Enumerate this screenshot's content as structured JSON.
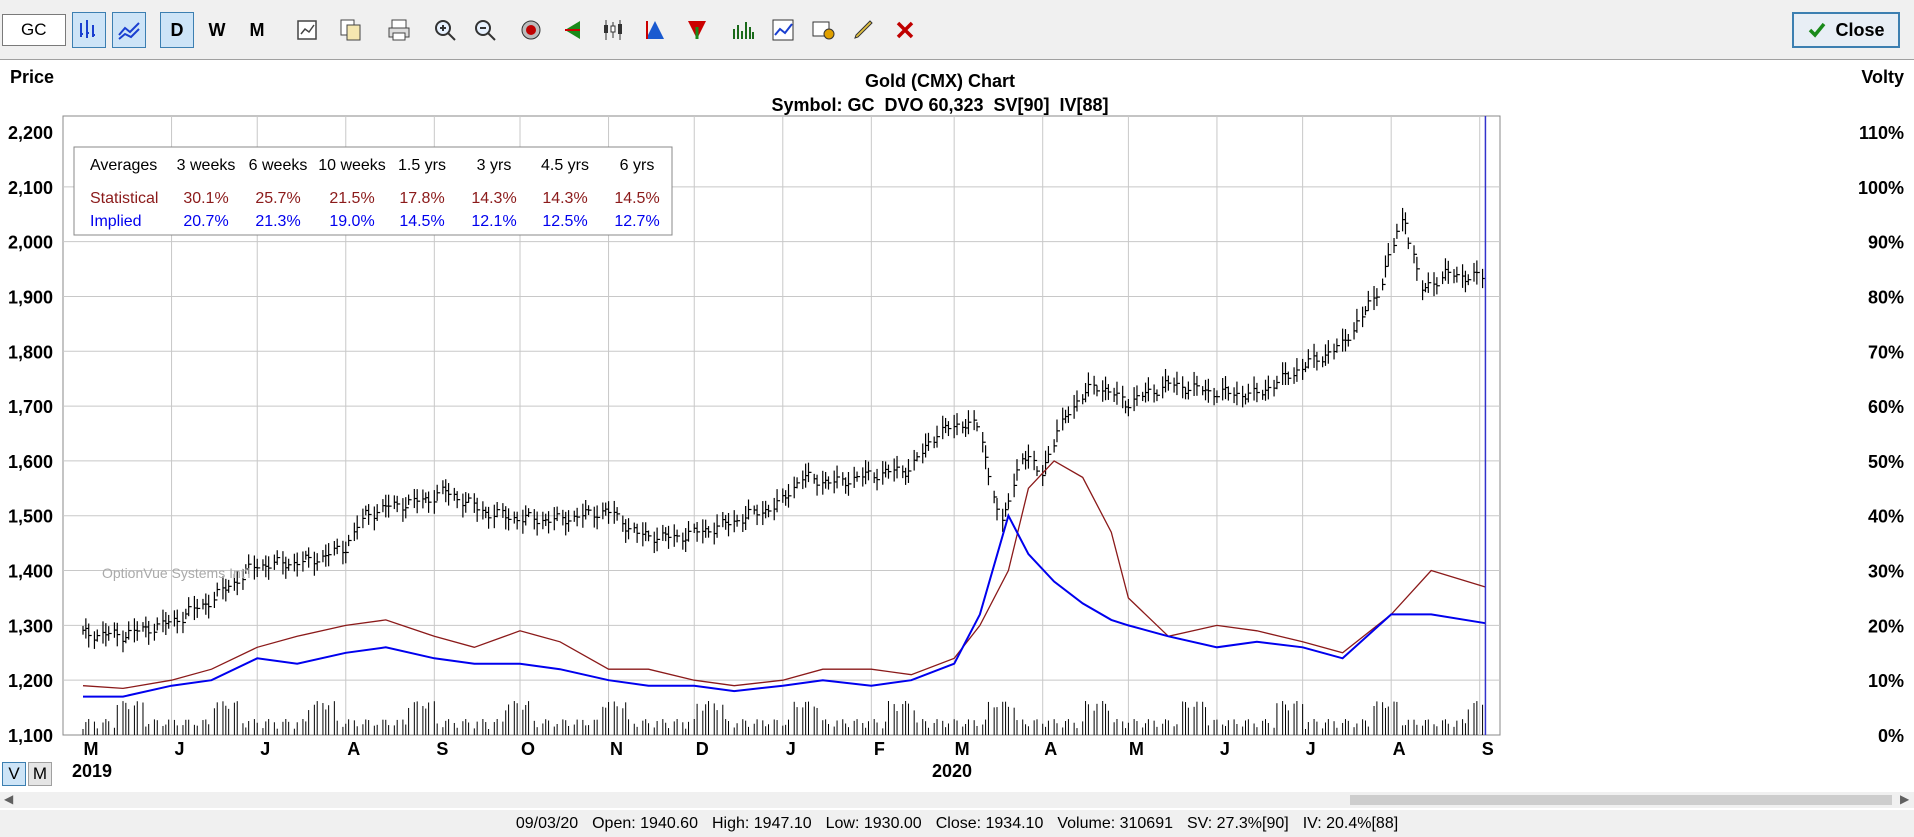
{
  "toolbar": {
    "symbol_value": "GC",
    "period_buttons": [
      "D",
      "W",
      "M"
    ],
    "close_label": "Close",
    "icons": [
      "bar-chart-icon",
      "line-chart-icon",
      "period-daily",
      "period-weekly",
      "period-monthly",
      "chart-settings-icon",
      "copy-icon",
      "print-icon",
      "zoom-in-icon",
      "zoom-out-icon",
      "target-icon",
      "left-arrow-icon",
      "candlestick-icon",
      "triangle-up-icon",
      "triangle-down-icon",
      "volume-icon",
      "study-icon",
      "annotation-icon",
      "pencil-icon",
      "delete-icon"
    ]
  },
  "chart_data": {
    "type": "line",
    "title": "Gold (CMX) Chart",
    "subtitle": "Symbol: GC  DVO 60,323  SV[90]  IV[88]",
    "ylabel": "Price",
    "y2label": "Volty",
    "ylim": [
      1100,
      2200
    ],
    "y2lim": [
      0,
      110
    ],
    "yticks": [
      "2,200",
      "2,100",
      "2,000",
      "1,900",
      "1,800",
      "1,700",
      "1,600",
      "1,500",
      "1,400",
      "1,300",
      "1,200",
      "1,100"
    ],
    "y2ticks": [
      "110%",
      "100%",
      "90%",
      "80%",
      "70%",
      "60%",
      "50%",
      "40%",
      "30%",
      "20%",
      "10%",
      "0%"
    ],
    "xticks": [
      "M",
      "J",
      "J",
      "A",
      "S",
      "O",
      "N",
      "D",
      "J",
      "F",
      "M",
      "A",
      "M",
      "J",
      "J",
      "A",
      "S"
    ],
    "years": [
      "2019",
      "2020"
    ],
    "x_dates": [
      "2019-05-01",
      "2019-06-01",
      "2019-07-01",
      "2019-08-01",
      "2019-09-01",
      "2019-10-01",
      "2019-11-01",
      "2019-12-01",
      "2020-01-01",
      "2020-02-01",
      "2020-03-01",
      "2020-04-01",
      "2020-05-01",
      "2020-06-01",
      "2020-07-01",
      "2020-08-01",
      "2020-09-01"
    ],
    "averages_table": {
      "header": [
        "Averages",
        "3 weeks",
        "6 weeks",
        "10 weeks",
        "1.5 yrs",
        "3 yrs",
        "4.5 yrs",
        "6 yrs"
      ],
      "rows": [
        {
          "label": "Statistical",
          "values": [
            "30.1%",
            "25.7%",
            "21.5%",
            "17.8%",
            "14.3%",
            "14.3%",
            "14.5%"
          ]
        },
        {
          "label": "Implied",
          "values": [
            "20.7%",
            "21.3%",
            "19.0%",
            "14.5%",
            "12.1%",
            "12.5%",
            "12.7%"
          ]
        }
      ]
    },
    "watermark": "OptionVue Systems Int'l",
    "colors": {
      "price": "#000000",
      "statistical": "#8b1a1a",
      "implied": "#0000ee",
      "grid": "#c8c8c8",
      "cursor": "#3333cc"
    },
    "series": [
      {
        "name": "Price",
        "axis": "price",
        "x": [
          "2019-05-01",
          "2019-05-15",
          "2019-06-01",
          "2019-06-15",
          "2019-07-01",
          "2019-07-10",
          "2019-07-20",
          "2019-08-01",
          "2019-08-08",
          "2019-08-15",
          "2019-08-30",
          "2019-09-05",
          "2019-09-20",
          "2019-10-01",
          "2019-10-15",
          "2019-11-01",
          "2019-11-12",
          "2019-11-25",
          "2019-12-10",
          "2019-12-31",
          "2020-01-08",
          "2020-01-20",
          "2020-02-01",
          "2020-02-15",
          "2020-02-24",
          "2020-03-05",
          "2020-03-10",
          "2020-03-18",
          "2020-03-25",
          "2020-04-01",
          "2020-04-10",
          "2020-04-20",
          "2020-05-01",
          "2020-05-15",
          "2020-06-01",
          "2020-06-15",
          "2020-07-01",
          "2020-07-15",
          "2020-07-27",
          "2020-08-06",
          "2020-08-12",
          "2020-08-20",
          "2020-09-03"
        ],
        "values": [
          1285,
          1282,
          1305,
          1345,
          1410,
          1412,
          1418,
          1440,
          1500,
          1515,
          1530,
          1545,
          1505,
          1495,
          1492,
          1510,
          1465,
          1460,
          1480,
          1520,
          1570,
          1560,
          1575,
          1585,
          1650,
          1670,
          1660,
          1480,
          1610,
          1580,
          1690,
          1740,
          1705,
          1740,
          1725,
          1720,
          1770,
          1810,
          1900,
          2050,
          1910,
          1940,
          1934
        ]
      },
      {
        "name": "Statistical",
        "axis": "volty",
        "x": [
          "2019-05-01",
          "2019-05-15",
          "2019-06-01",
          "2019-06-15",
          "2019-07-01",
          "2019-07-15",
          "2019-08-01",
          "2019-08-15",
          "2019-09-01",
          "2019-09-15",
          "2019-10-01",
          "2019-10-15",
          "2019-11-01",
          "2019-11-15",
          "2019-12-01",
          "2019-12-15",
          "2020-01-01",
          "2020-01-15",
          "2020-02-01",
          "2020-02-15",
          "2020-03-01",
          "2020-03-10",
          "2020-03-20",
          "2020-03-27",
          "2020-04-05",
          "2020-04-15",
          "2020-04-25",
          "2020-05-01",
          "2020-05-15",
          "2020-06-01",
          "2020-06-15",
          "2020-07-01",
          "2020-07-15",
          "2020-08-01",
          "2020-08-15",
          "2020-09-03"
        ],
        "values": [
          9,
          8.5,
          10,
          12,
          16,
          18,
          20,
          21,
          18,
          16,
          19,
          17,
          12,
          12,
          10,
          9,
          10,
          12,
          12,
          11,
          14,
          20,
          30,
          45,
          50,
          47,
          37,
          25,
          18,
          20,
          19,
          17,
          15,
          22,
          30,
          27
        ]
      },
      {
        "name": "Implied",
        "axis": "volty",
        "x": [
          "2019-05-01",
          "2019-05-15",
          "2019-06-01",
          "2019-06-15",
          "2019-07-01",
          "2019-07-15",
          "2019-08-01",
          "2019-08-15",
          "2019-09-01",
          "2019-09-15",
          "2019-10-01",
          "2019-10-15",
          "2019-11-01",
          "2019-11-15",
          "2019-12-01",
          "2019-12-15",
          "2020-01-01",
          "2020-01-15",
          "2020-02-01",
          "2020-02-15",
          "2020-03-01",
          "2020-03-10",
          "2020-03-20",
          "2020-03-27",
          "2020-04-05",
          "2020-04-15",
          "2020-04-25",
          "2020-05-01",
          "2020-05-15",
          "2020-06-01",
          "2020-06-15",
          "2020-07-01",
          "2020-07-15",
          "2020-08-01",
          "2020-08-15",
          "2020-09-03"
        ],
        "values": [
          7,
          7,
          9,
          10,
          14,
          13,
          15,
          16,
          14,
          13,
          13,
          12,
          10,
          9,
          9,
          8,
          9,
          10,
          9,
          10,
          13,
          22,
          40,
          33,
          28,
          24,
          21,
          20,
          18,
          16,
          17,
          16,
          14,
          22,
          22,
          20.4
        ]
      }
    ]
  },
  "status": {
    "date": "09/03/20",
    "open": "Open: 1940.60",
    "high": "High: 1947.10",
    "low": "Low: 1930.00",
    "close": "Close: 1934.10",
    "volume": "Volume: 310691",
    "sv": "SV: 27.3%[90]",
    "iv": "IV: 20.4%[88]"
  },
  "view_toggle": [
    "V",
    "M"
  ]
}
